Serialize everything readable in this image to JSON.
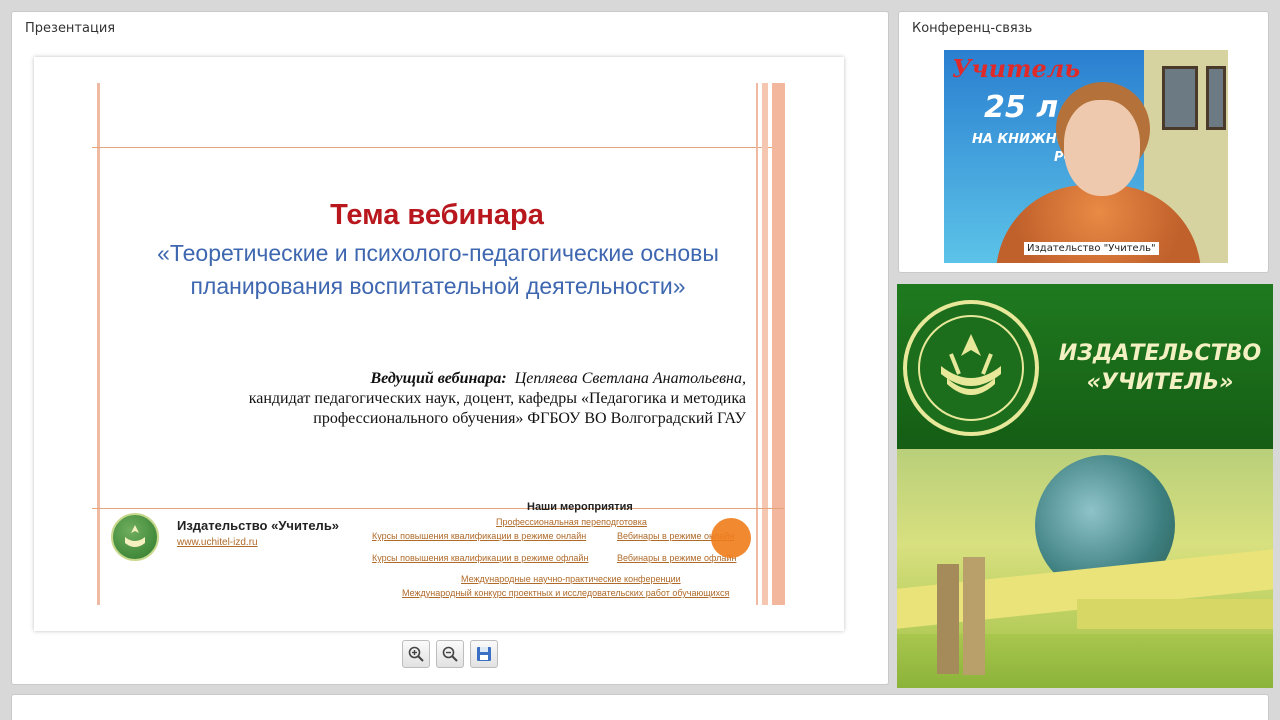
{
  "panels": {
    "presentation_title": "Презентация",
    "conference_title": "Конференц-связь"
  },
  "slide": {
    "title": "Тема вебинара",
    "subtitle": "«Теоретические и психолого-педагогические основы планирования воспитательной деятельности»",
    "host_label": "Ведущий вебинара:",
    "host_name": "Цепляева Светлана Анатольевна,",
    "host_line2": "кандидат педагогических наук,  доцент, кафедры «Педагогика и методика",
    "host_line3": "профессионального обучения» ФГБОУ ВО Волгоградский ГАУ",
    "footer_brand": "Издательство «Учитель»",
    "footer_url": "www.uchitel-izd.ru",
    "events_heading": "Наши мероприятия",
    "events": [
      "Профессиональная  переподготовка",
      "Курсы повышения квалификации  в режиме онлайн",
      "Вебинары  в режиме онлайн",
      "Курсы повышения квалификации  в режиме офлайн",
      "Вебинары  в режиме офлайн",
      "Международные  научно-практические  конференции",
      "Международный  конкурс проектных  и исследовательских  работ обучающихся"
    ]
  },
  "toolbar": {
    "zoom_in": "zoom-in-icon",
    "zoom_out": "zoom-out-icon",
    "save": "save-icon"
  },
  "video": {
    "caption": "Издательство \"Учитель\"",
    "background_text_brand": "Учитель",
    "background_text_years": "25 л",
    "background_text_line": "НА КНИЖНО",
    "background_text_ros": "РОС"
  },
  "banner": {
    "line1": "ИЗДАТЕЛЬСТВО",
    "line2": "«УЧИТЕЛЬ»"
  },
  "colors": {
    "title_red": "#b8181d",
    "subtitle_blue": "#3e67b0",
    "link_orange": "#b06a2a",
    "banner_green": "#1f7a1f"
  }
}
